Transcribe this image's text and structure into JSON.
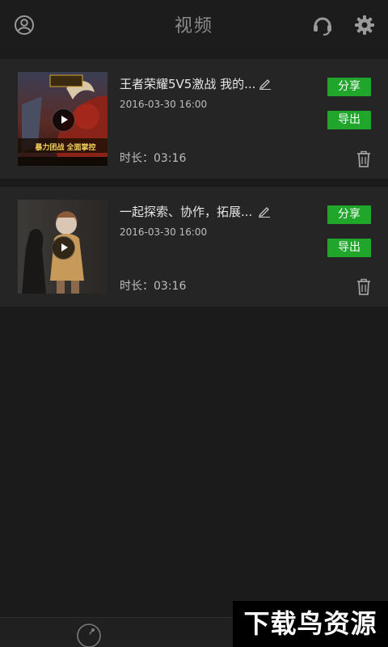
{
  "header": {
    "title": "视频",
    "left_icon": "user-profile-icon",
    "right_icons": [
      "headset-icon",
      "gear-icon"
    ]
  },
  "videos": [
    {
      "title": "王者荣耀5V5激战 我的...",
      "date": "2016-03-30  16:00",
      "duration": "时长：03:16",
      "share_label": "分享",
      "export_label": "导出",
      "thumbnail_caption": "暴力团战 全面掌控"
    },
    {
      "title": "一起探索、协作，拓展...",
      "date": "2016-03-30  16:00",
      "duration": "时长：03:16",
      "share_label": "分享",
      "export_label": "导出"
    }
  ],
  "watermark": "下载鸟资源",
  "colors": {
    "background": "#1b1b1b",
    "card": "#252525",
    "accent_green": "#1fa62b"
  }
}
